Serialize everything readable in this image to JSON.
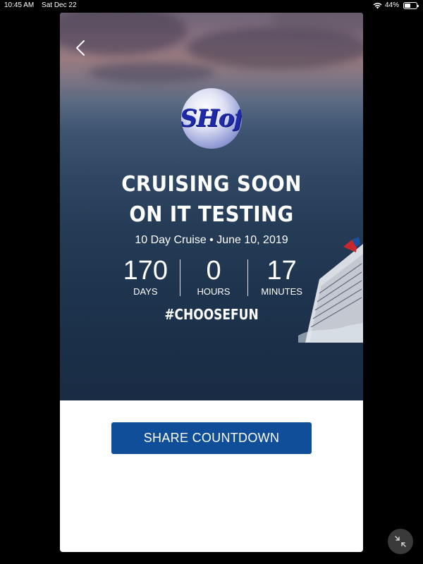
{
  "status_bar": {
    "time": "10:45 AM",
    "date": "Sat Dec 22",
    "battery": "44%",
    "wifi_icon": "wifi-icon",
    "battery_icon": "battery-icon",
    "battery_level": 0.44
  },
  "header": {
    "back_icon": "chevron-left-icon",
    "logo_text": "SHof"
  },
  "cruise": {
    "title_line1": "CRUISING SOON",
    "title_line2": "ON IT TESTING",
    "subtitle": "10 Day Cruise • June 10, 2019",
    "hashtag": "#CHOOSEFUN"
  },
  "countdown": [
    {
      "value": "170",
      "label": "DAYS"
    },
    {
      "value": "0",
      "label": "HOURS"
    },
    {
      "value": "17",
      "label": "MINUTES"
    }
  ],
  "actions": {
    "share_label": "SHARE COUNTDOWN",
    "share_color": "#104e9a",
    "collapse_icon": "collapse-arrows-icon"
  }
}
